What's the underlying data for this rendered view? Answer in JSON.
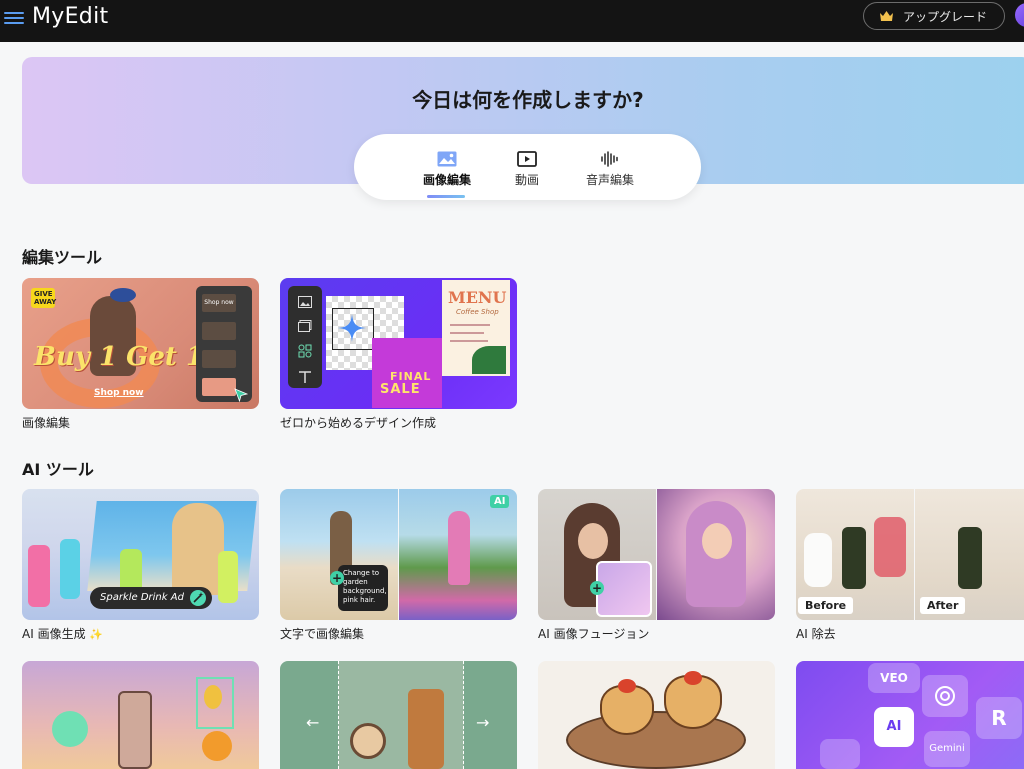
{
  "header": {
    "brand": "MyEdit",
    "upgrade_label": "アップグレード"
  },
  "hero": {
    "title": "今日は何を作成しますか?",
    "tabs": [
      {
        "label": "画像編集",
        "icon": "image-icon",
        "active": true
      },
      {
        "label": "動画",
        "icon": "video-play-icon",
        "active": false
      },
      {
        "label": "音声編集",
        "icon": "audio-wave-icon",
        "active": false
      }
    ]
  },
  "sections": {
    "edit_tools": {
      "title": "編集ツール",
      "cards": [
        {
          "label": "画像編集",
          "overlay": {
            "giveaway": "GIVE AWAY",
            "promo": "Buy 1 Get 1",
            "shop": "Shop now",
            "shop_btn": "Shop now"
          }
        },
        {
          "label": "ゼロから始めるデザイン作成",
          "overlay": {
            "menu": "MENU",
            "menu_sub": "Coffee Shop",
            "sale_top": "FINAL",
            "sale_bottom": "SALE"
          }
        }
      ]
    },
    "ai_tools": {
      "title": "AI ツール",
      "cards": [
        {
          "label": "AI 画像生成",
          "overlay": {
            "prompt": "Sparkle Drink Ad"
          }
        },
        {
          "label": "文字で画像編集",
          "overlay": {
            "prompt": "Change to garden background, pink hair.",
            "ai_badge": "AI"
          }
        },
        {
          "label": "AI 画像フュージョン",
          "overlay": {}
        },
        {
          "label": "AI 除去",
          "overlay": {
            "before": "Before",
            "after": "After"
          }
        }
      ]
    },
    "row3": {
      "cards": [
        {
          "label": "",
          "overlay": {}
        },
        {
          "label": "",
          "overlay": {}
        },
        {
          "label": "",
          "overlay": {}
        },
        {
          "label": "",
          "overlay": {
            "veo": "VEO",
            "ai": "AI",
            "gemini": "Gemini"
          }
        }
      ]
    }
  },
  "colors": {
    "topbar": "#141414",
    "accent_blue": "#5a9cf0",
    "crown": "#f2c14e"
  }
}
